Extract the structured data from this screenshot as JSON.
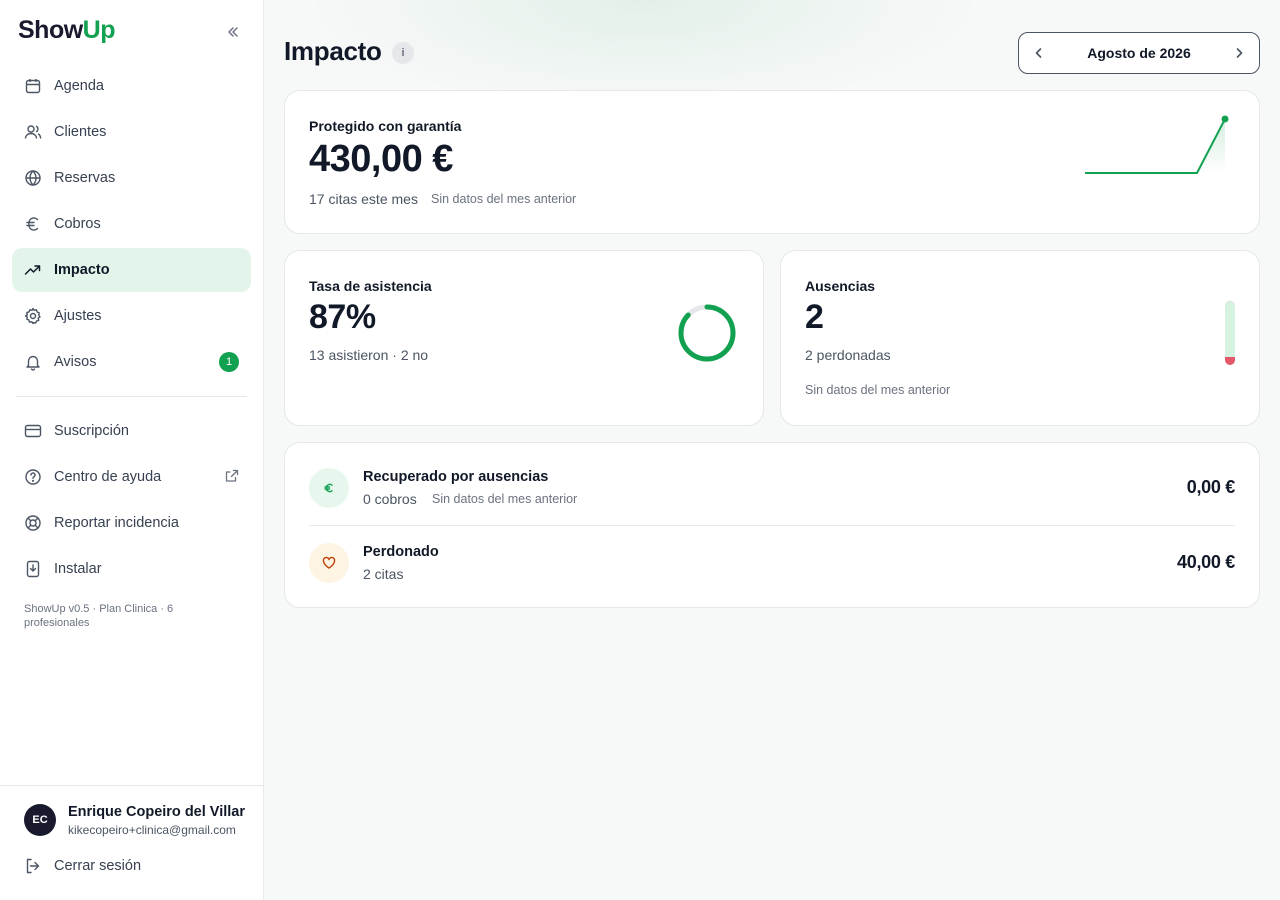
{
  "sidebar": {
    "logo": {
      "show": "Show",
      "up": "Up"
    },
    "nav": [
      {
        "label": "Agenda",
        "icon": "calendar-icon"
      },
      {
        "label": "Clientes",
        "icon": "users-icon"
      },
      {
        "label": "Reservas",
        "icon": "globe-icon"
      },
      {
        "label": "Cobros",
        "icon": "euro-icon"
      },
      {
        "label": "Impacto",
        "icon": "trending-up-icon",
        "active": true
      },
      {
        "label": "Ajustes",
        "icon": "gear-icon"
      },
      {
        "label": "Avisos",
        "icon": "bell-icon",
        "badge": "1"
      }
    ],
    "secondary": [
      {
        "label": "Suscripción",
        "icon": "credit-card-icon"
      },
      {
        "label": "Centro de ayuda",
        "icon": "help-circle-icon"
      },
      {
        "label": "Reportar incidencia",
        "icon": "lifebuoy-icon"
      },
      {
        "label": "Instalar",
        "icon": "install-icon"
      }
    ],
    "version": "ShowUp v0.5 · Plan Clinica · 6 profesionales",
    "user": {
      "initials": "EC",
      "name": "Enrique Copeiro del Villar",
      "email": "kikecopeiro+clinica@gmail.com"
    },
    "logout_label": "Cerrar sesión"
  },
  "header": {
    "title": "Impacto",
    "info": "i",
    "month": "Agosto de 2026"
  },
  "protected": {
    "title": "Protegido con garantía",
    "amount": "430,00 €",
    "count": "17 citas este mes",
    "compare": "Sin datos del mes anterior",
    "trend": [
      0,
      0,
      0,
      0,
      0,
      1
    ]
  },
  "attendance": {
    "title": "Tasa de asistencia",
    "value": "87%",
    "detail": "13 asistieron · 2 no",
    "rate": 0.87
  },
  "absences": {
    "title": "Ausencias",
    "value": "2",
    "detail": "2 perdonadas",
    "compare": "Sin datos del mes anterior",
    "forgiven_fraction": 0.87
  },
  "summary": [
    {
      "icon": "euro-icon",
      "title": "Recuperado por ausencias",
      "detail": "0 cobros",
      "compare": "Sin datos del mes anterior",
      "amount": "0,00 €"
    },
    {
      "icon": "heart-icon",
      "title": "Perdonado",
      "detail": "2 citas",
      "amount": "40,00 €"
    }
  ],
  "colors": {
    "accent": "#12a150",
    "accent_bg": "#e3f5ea",
    "danger": "#e5586b",
    "warm_bg": "#fdf4e3"
  }
}
